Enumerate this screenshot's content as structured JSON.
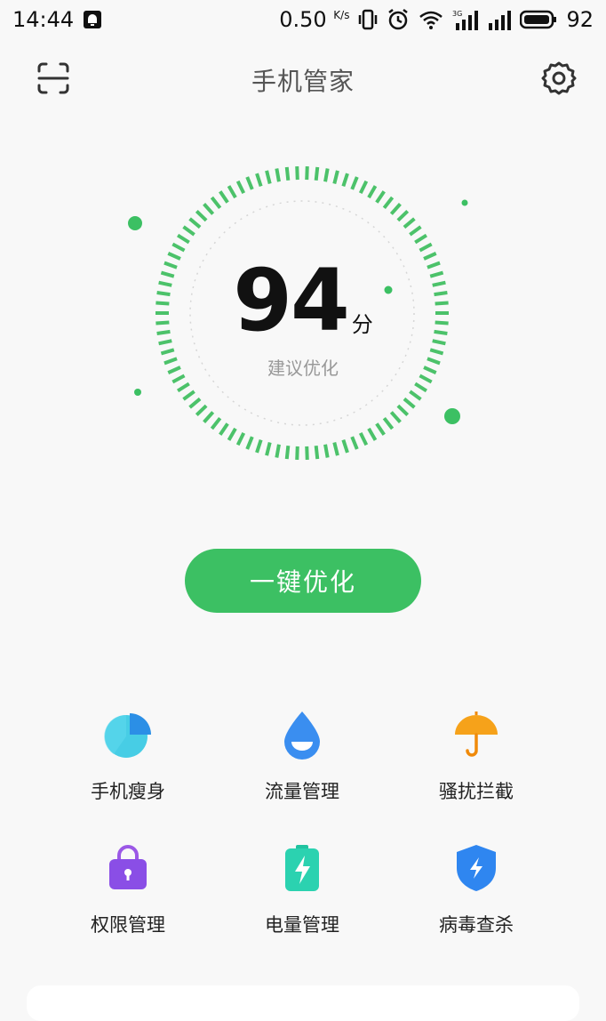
{
  "status_bar": {
    "time": "14:44",
    "net_speed": "0.50",
    "net_unit": "K/s",
    "battery": "92"
  },
  "header": {
    "title": "手机管家"
  },
  "score": {
    "value": "94",
    "unit": "分",
    "advice": "建议优化"
  },
  "colors": {
    "accent": "#3cc063",
    "ring": "#4cc26a"
  },
  "optimize_button": {
    "label": "一键优化"
  },
  "tools": [
    {
      "label": "手机瘦身",
      "icon": "pie-chart-icon"
    },
    {
      "label": "流量管理",
      "icon": "water-drop-icon"
    },
    {
      "label": "骚扰拦截",
      "icon": "umbrella-icon"
    },
    {
      "label": "权限管理",
      "icon": "lock-icon"
    },
    {
      "label": "电量管理",
      "icon": "battery-bolt-icon"
    },
    {
      "label": "病毒查杀",
      "icon": "shield-icon"
    }
  ]
}
